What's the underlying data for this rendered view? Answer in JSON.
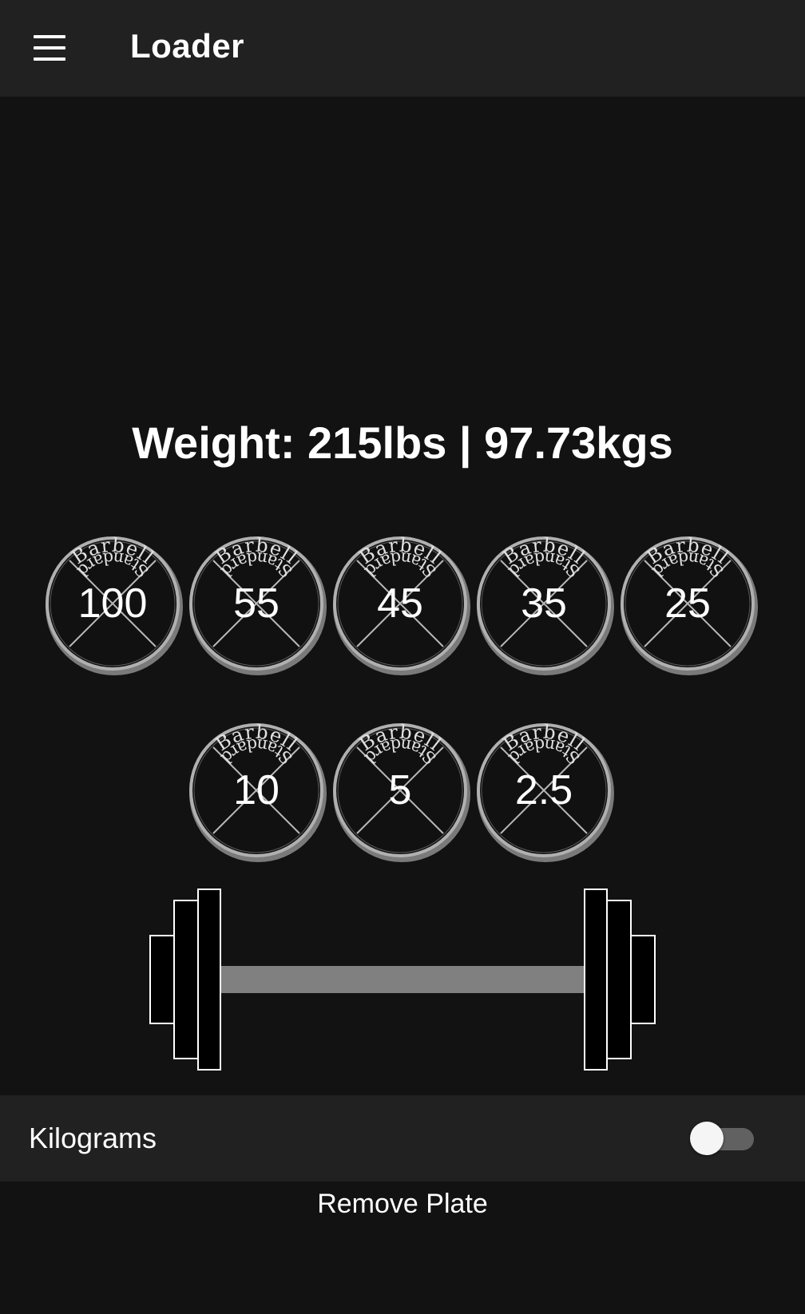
{
  "toolbar": {
    "title": "Loader",
    "menu_icon": "hamburger-menu-icon"
  },
  "weight": {
    "text": "Weight: 215lbs | 97.73kgs"
  },
  "plate_brand": {
    "top_text": "Barbell",
    "bottom_text": "Standard"
  },
  "plates": [
    {
      "label": "100"
    },
    {
      "label": "55"
    },
    {
      "label": "45"
    },
    {
      "label": "35"
    },
    {
      "label": "25"
    },
    {
      "label": "10"
    },
    {
      "label": "5"
    },
    {
      "label": "2.5"
    }
  ],
  "settings": {
    "kilograms_label": "Kilograms",
    "kilograms_enabled": false
  },
  "actions": {
    "remove_plate_label": "Remove Plate"
  },
  "colors": {
    "background": "#121212",
    "toolbar": "#212121",
    "bar": "#808080",
    "plate_rim": "#9e9e9e"
  }
}
